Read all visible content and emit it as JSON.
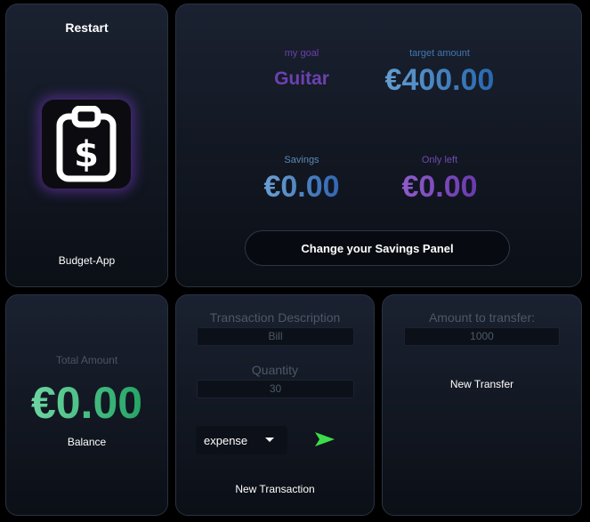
{
  "left_card": {
    "restart_label": "Restart",
    "app_name": "Budget-App",
    "logo_icon": "clipboard-dollar-icon"
  },
  "goal_panel": {
    "goal_label": "my goal",
    "goal_value": "Guitar",
    "target_label": "target amount",
    "target_value": "€400.00",
    "savings_label": "Savings",
    "savings_value": "€0.00",
    "only_left_label": "Only left",
    "only_left_value": "€0.00",
    "change_button_label": "Change your Savings Panel"
  },
  "balance_panel": {
    "total_label": "Total Amount",
    "balance_value": "€0.00",
    "balance_label": "Balance"
  },
  "transaction_panel": {
    "description_label": "Transaction Description",
    "description_placeholder": "Bill",
    "quantity_label": "Quantity",
    "quantity_placeholder": "30",
    "type_selected": "expense",
    "send_icon": "send-arrow-icon",
    "footer_label": "New Transaction"
  },
  "transfer_panel": {
    "amount_label": "Amount to transfer:",
    "amount_placeholder": "1000",
    "footer_label": "New Transfer"
  },
  "colors": {
    "background": "#000000",
    "panel_border": "#2a3242",
    "send_icon": "#3ddc4a",
    "balance_green": "#139a58"
  }
}
